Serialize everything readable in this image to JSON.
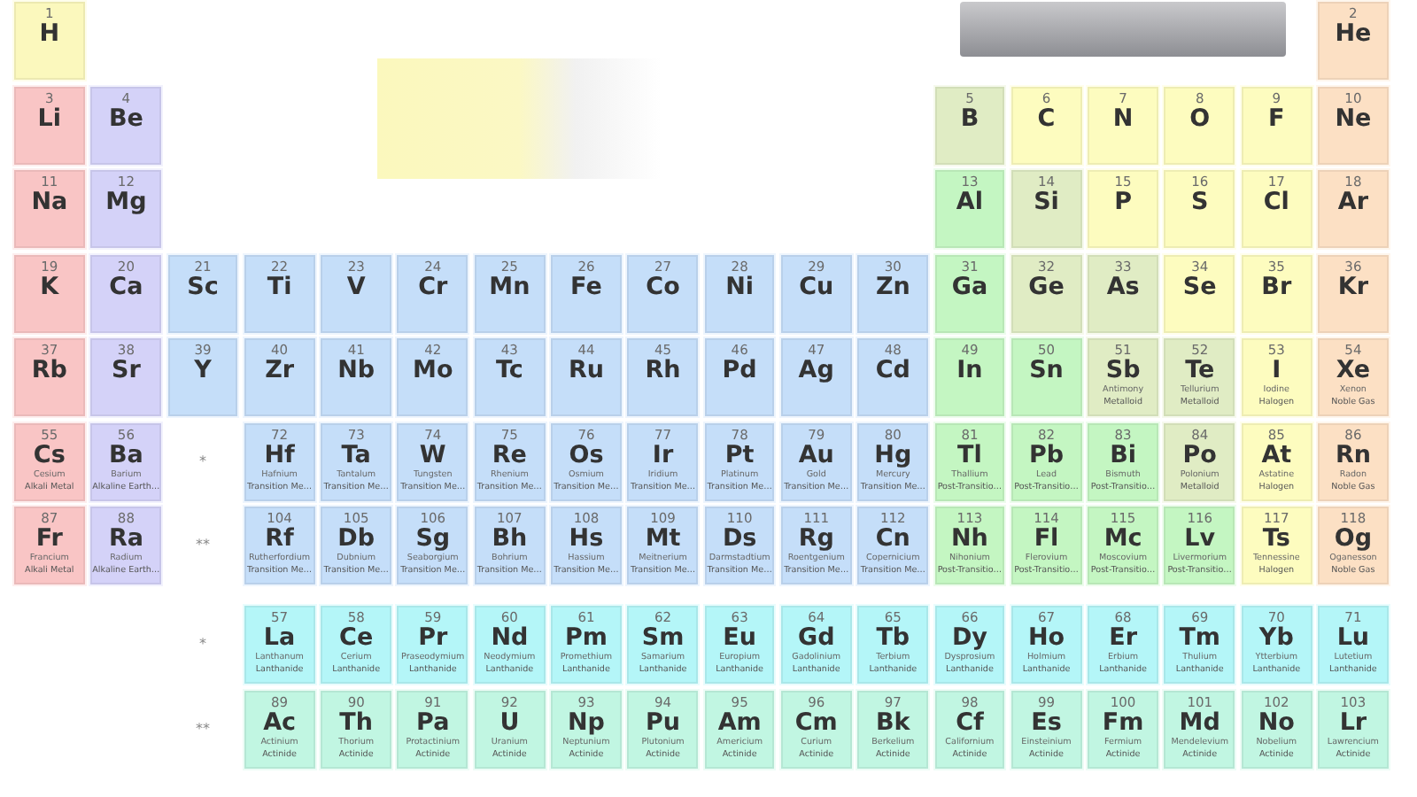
{
  "table": {
    "rows": [
      {
        "cells": [
          {
            "kind": "element",
            "number": "1",
            "symbol": "H",
            "color": "#fbf8bd"
          },
          {
            "kind": "empty"
          },
          {
            "kind": "empty"
          },
          {
            "kind": "empty"
          },
          {
            "kind": "empty"
          },
          {
            "kind": "empty"
          },
          {
            "kind": "empty"
          },
          {
            "kind": "empty"
          },
          {
            "kind": "empty"
          },
          {
            "kind": "empty"
          },
          {
            "kind": "empty"
          },
          {
            "kind": "empty"
          },
          {
            "kind": "empty"
          },
          {
            "kind": "empty"
          },
          {
            "kind": "empty"
          },
          {
            "kind": "empty"
          },
          {
            "kind": "empty"
          },
          {
            "kind": "element",
            "number": "2",
            "symbol": "He",
            "color": "#fce0c4"
          }
        ]
      },
      {
        "cells": [
          {
            "kind": "element",
            "number": "3",
            "symbol": "Li",
            "color": "#f9c5c5"
          },
          {
            "kind": "element",
            "number": "4",
            "symbol": "Be",
            "color": "#d4d2f8"
          },
          {
            "kind": "empty"
          },
          {
            "kind": "empty"
          },
          {
            "kind": "empty"
          },
          {
            "kind": "empty"
          },
          {
            "kind": "empty"
          },
          {
            "kind": "empty"
          },
          {
            "kind": "empty"
          },
          {
            "kind": "empty"
          },
          {
            "kind": "empty"
          },
          {
            "kind": "empty"
          },
          {
            "kind": "element",
            "number": "5",
            "symbol": "B",
            "color": "#e0ecc4"
          },
          {
            "kind": "element",
            "number": "6",
            "symbol": "C",
            "color": "#fdfcbf"
          },
          {
            "kind": "element",
            "number": "7",
            "symbol": "N",
            "color": "#fdfcbf"
          },
          {
            "kind": "element",
            "number": "8",
            "symbol": "O",
            "color": "#fdfcbf"
          },
          {
            "kind": "element",
            "number": "9",
            "symbol": "F",
            "color": "#fdfcbf"
          },
          {
            "kind": "element",
            "number": "10",
            "symbol": "Ne",
            "color": "#fce0c4"
          }
        ]
      },
      {
        "cells": [
          {
            "kind": "element",
            "number": "11",
            "symbol": "Na",
            "color": "#f9c5c5"
          },
          {
            "kind": "element",
            "number": "12",
            "symbol": "Mg",
            "color": "#d4d2f8"
          },
          {
            "kind": "empty"
          },
          {
            "kind": "empty"
          },
          {
            "kind": "empty"
          },
          {
            "kind": "empty"
          },
          {
            "kind": "empty"
          },
          {
            "kind": "empty"
          },
          {
            "kind": "empty"
          },
          {
            "kind": "empty"
          },
          {
            "kind": "empty"
          },
          {
            "kind": "empty"
          },
          {
            "kind": "element",
            "number": "13",
            "symbol": "Al",
            "color": "#c4f6c2"
          },
          {
            "kind": "element",
            "number": "14",
            "symbol": "Si",
            "color": "#e0ecc4"
          },
          {
            "kind": "element",
            "number": "15",
            "symbol": "P",
            "color": "#fdfcbf"
          },
          {
            "kind": "element",
            "number": "16",
            "symbol": "S",
            "color": "#fdfcbf"
          },
          {
            "kind": "element",
            "number": "17",
            "symbol": "Cl",
            "color": "#fdfcbf"
          },
          {
            "kind": "element",
            "number": "18",
            "symbol": "Ar",
            "color": "#fce0c4"
          }
        ]
      },
      {
        "cells": [
          {
            "kind": "element",
            "number": "19",
            "symbol": "K",
            "color": "#f9c5c5"
          },
          {
            "kind": "element",
            "number": "20",
            "symbol": "Ca",
            "color": "#d4d2f8"
          },
          {
            "kind": "element",
            "number": "21",
            "symbol": "Sc",
            "color": "#c5def9"
          },
          {
            "kind": "element",
            "number": "22",
            "symbol": "Ti",
            "color": "#c5def9"
          },
          {
            "kind": "element",
            "number": "23",
            "symbol": "V",
            "color": "#c5def9"
          },
          {
            "kind": "element",
            "number": "24",
            "symbol": "Cr",
            "color": "#c5def9"
          },
          {
            "kind": "element",
            "number": "25",
            "symbol": "Mn",
            "color": "#c5def9"
          },
          {
            "kind": "element",
            "number": "26",
            "symbol": "Fe",
            "color": "#c5def9"
          },
          {
            "kind": "element",
            "number": "27",
            "symbol": "Co",
            "color": "#c5def9"
          },
          {
            "kind": "element",
            "number": "28",
            "symbol": "Ni",
            "color": "#c5def9"
          },
          {
            "kind": "element",
            "number": "29",
            "symbol": "Cu",
            "color": "#c5def9"
          },
          {
            "kind": "element",
            "number": "30",
            "symbol": "Zn",
            "color": "#c5def9"
          },
          {
            "kind": "element",
            "number": "31",
            "symbol": "Ga",
            "color": "#c4f6c2"
          },
          {
            "kind": "element",
            "number": "32",
            "symbol": "Ge",
            "color": "#e0ecc4"
          },
          {
            "kind": "element",
            "number": "33",
            "symbol": "As",
            "color": "#e0ecc4"
          },
          {
            "kind": "element",
            "number": "34",
            "symbol": "Se",
            "color": "#fdfcbf"
          },
          {
            "kind": "element",
            "number": "35",
            "symbol": "Br",
            "color": "#fdfcbf"
          },
          {
            "kind": "element",
            "number": "36",
            "symbol": "Kr",
            "color": "#fce0c4"
          }
        ]
      },
      {
        "cells": [
          {
            "kind": "element",
            "number": "37",
            "symbol": "Rb",
            "color": "#f9c5c5"
          },
          {
            "kind": "element",
            "number": "38",
            "symbol": "Sr",
            "color": "#d4d2f8"
          },
          {
            "kind": "element",
            "number": "39",
            "symbol": "Y",
            "color": "#c5def9"
          },
          {
            "kind": "element",
            "number": "40",
            "symbol": "Zr",
            "color": "#c5def9"
          },
          {
            "kind": "element",
            "number": "41",
            "symbol": "Nb",
            "color": "#c5def9"
          },
          {
            "kind": "element",
            "number": "42",
            "symbol": "Mo",
            "color": "#c5def9"
          },
          {
            "kind": "element",
            "number": "43",
            "symbol": "Tc",
            "color": "#c5def9"
          },
          {
            "kind": "element",
            "number": "44",
            "symbol": "Ru",
            "color": "#c5def9"
          },
          {
            "kind": "element",
            "number": "45",
            "symbol": "Rh",
            "color": "#c5def9"
          },
          {
            "kind": "element",
            "number": "46",
            "symbol": "Pd",
            "color": "#c5def9"
          },
          {
            "kind": "element",
            "number": "47",
            "symbol": "Ag",
            "color": "#c5def9"
          },
          {
            "kind": "element",
            "number": "48",
            "symbol": "Cd",
            "color": "#c5def9"
          },
          {
            "kind": "element",
            "number": "49",
            "symbol": "In",
            "color": "#c4f6c2"
          },
          {
            "kind": "element",
            "number": "50",
            "symbol": "Sn",
            "color": "#c4f6c2"
          },
          {
            "kind": "element",
            "number": "51",
            "symbol": "Sb",
            "name": "Antimony",
            "category": "Metalloid",
            "color": "#e0ecc4"
          },
          {
            "kind": "element",
            "number": "52",
            "symbol": "Te",
            "name": "Tellurium",
            "category": "Metalloid",
            "color": "#e0ecc4"
          },
          {
            "kind": "element",
            "number": "53",
            "symbol": "I",
            "name": "Iodine",
            "category": "Halogen",
            "color": "#fdfcbf"
          },
          {
            "kind": "element",
            "number": "54",
            "symbol": "Xe",
            "name": "Xenon",
            "category": "Noble Gas",
            "color": "#fce0c4"
          }
        ]
      },
      {
        "cells": [
          {
            "kind": "element",
            "number": "55",
            "symbol": "Cs",
            "name": "Cesium",
            "category": "Alkali Metal",
            "color": "#f9c5c5"
          },
          {
            "kind": "element",
            "number": "56",
            "symbol": "Ba",
            "name": "Barium",
            "category": "Alkaline Earth…",
            "color": "#d4d2f8"
          },
          {
            "kind": "marker",
            "text": "*"
          },
          {
            "kind": "element",
            "number": "72",
            "symbol": "Hf",
            "name": "Hafnium",
            "category": "Transition Me…",
            "color": "#c5def9"
          },
          {
            "kind": "element",
            "number": "73",
            "symbol": "Ta",
            "name": "Tantalum",
            "category": "Transition Me…",
            "color": "#c5def9"
          },
          {
            "kind": "element",
            "number": "74",
            "symbol": "W",
            "name": "Tungsten",
            "category": "Transition Me…",
            "color": "#c5def9"
          },
          {
            "kind": "element",
            "number": "75",
            "symbol": "Re",
            "name": "Rhenium",
            "category": "Transition Me…",
            "color": "#c5def9"
          },
          {
            "kind": "element",
            "number": "76",
            "symbol": "Os",
            "name": "Osmium",
            "category": "Transition Me…",
            "color": "#c5def9"
          },
          {
            "kind": "element",
            "number": "77",
            "symbol": "Ir",
            "name": "Iridium",
            "category": "Transition Me…",
            "color": "#c5def9"
          },
          {
            "kind": "element",
            "number": "78",
            "symbol": "Pt",
            "name": "Platinum",
            "category": "Transition Me…",
            "color": "#c5def9"
          },
          {
            "kind": "element",
            "number": "79",
            "symbol": "Au",
            "name": "Gold",
            "category": "Transition Me…",
            "color": "#c5def9"
          },
          {
            "kind": "element",
            "number": "80",
            "symbol": "Hg",
            "name": "Mercury",
            "category": "Transition Me…",
            "color": "#c5def9"
          },
          {
            "kind": "element",
            "number": "81",
            "symbol": "Tl",
            "name": "Thallium",
            "category": "Post-Transitio…",
            "color": "#c4f6c2"
          },
          {
            "kind": "element",
            "number": "82",
            "symbol": "Pb",
            "name": "Lead",
            "category": "Post-Transitio…",
            "color": "#c4f6c2"
          },
          {
            "kind": "element",
            "number": "83",
            "symbol": "Bi",
            "name": "Bismuth",
            "category": "Post-Transitio…",
            "color": "#c4f6c2"
          },
          {
            "kind": "element",
            "number": "84",
            "symbol": "Po",
            "name": "Polonium",
            "category": "Metalloid",
            "color": "#e0ecc4"
          },
          {
            "kind": "element",
            "number": "85",
            "symbol": "At",
            "name": "Astatine",
            "category": "Halogen",
            "color": "#fdfcbf"
          },
          {
            "kind": "element",
            "number": "86",
            "symbol": "Rn",
            "name": "Radon",
            "category": "Noble Gas",
            "color": "#fce0c4"
          }
        ]
      },
      {
        "cells": [
          {
            "kind": "element",
            "number": "87",
            "symbol": "Fr",
            "name": "Francium",
            "category": "Alkali Metal",
            "color": "#f9c5c5"
          },
          {
            "kind": "element",
            "number": "88",
            "symbol": "Ra",
            "name": "Radium",
            "category": "Alkaline Earth…",
            "color": "#d4d2f8"
          },
          {
            "kind": "marker",
            "text": "**"
          },
          {
            "kind": "element",
            "number": "104",
            "symbol": "Rf",
            "name": "Rutherfordium",
            "category": "Transition Me…",
            "color": "#c5def9"
          },
          {
            "kind": "element",
            "number": "105",
            "symbol": "Db",
            "name": "Dubnium",
            "category": "Transition Me…",
            "color": "#c5def9"
          },
          {
            "kind": "element",
            "number": "106",
            "symbol": "Sg",
            "name": "Seaborgium",
            "category": "Transition Me…",
            "color": "#c5def9"
          },
          {
            "kind": "element",
            "number": "107",
            "symbol": "Bh",
            "name": "Bohrium",
            "category": "Transition Me…",
            "color": "#c5def9"
          },
          {
            "kind": "element",
            "number": "108",
            "symbol": "Hs",
            "name": "Hassium",
            "category": "Transition Me…",
            "color": "#c5def9"
          },
          {
            "kind": "element",
            "number": "109",
            "symbol": "Mt",
            "name": "Meitnerium",
            "category": "Transition Me…",
            "color": "#c5def9"
          },
          {
            "kind": "element",
            "number": "110",
            "symbol": "Ds",
            "name": "Darmstadtium",
            "category": "Transition Me…",
            "color": "#c5def9"
          },
          {
            "kind": "element",
            "number": "111",
            "symbol": "Rg",
            "name": "Roentgenium",
            "category": "Transition Me…",
            "color": "#c5def9"
          },
          {
            "kind": "element",
            "number": "112",
            "symbol": "Cn",
            "name": "Copernicium",
            "category": "Transition Me…",
            "color": "#c5def9"
          },
          {
            "kind": "element",
            "number": "113",
            "symbol": "Nh",
            "name": "Nihonium",
            "category": "Post-Transitio…",
            "color": "#c4f6c2"
          },
          {
            "kind": "element",
            "number": "114",
            "symbol": "Fl",
            "name": "Flerovium",
            "category": "Post-Transitio…",
            "color": "#c4f6c2"
          },
          {
            "kind": "element",
            "number": "115",
            "symbol": "Mc",
            "name": "Moscovium",
            "category": "Post-Transitio…",
            "color": "#c4f6c2"
          },
          {
            "kind": "element",
            "number": "116",
            "symbol": "Lv",
            "name": "Livermorium",
            "category": "Post-Transitio…",
            "color": "#c4f6c2"
          },
          {
            "kind": "element",
            "number": "117",
            "symbol": "Ts",
            "name": "Tennessine",
            "category": "Halogen",
            "color": "#fdfcbf"
          },
          {
            "kind": "element",
            "number": "118",
            "symbol": "Og",
            "name": "Oganesson",
            "category": "Noble Gas",
            "color": "#fce0c4"
          }
        ]
      }
    ]
  },
  "f_block": {
    "rows": [
      {
        "cells": [
          {
            "kind": "empty"
          },
          {
            "kind": "empty"
          },
          {
            "kind": "marker",
            "text": "*"
          },
          {
            "kind": "element",
            "number": "57",
            "symbol": "La",
            "name": "Lanthanum",
            "category": "Lanthanide",
            "color": "#b4f6f8"
          },
          {
            "kind": "element",
            "number": "58",
            "symbol": "Ce",
            "name": "Cerium",
            "category": "Lanthanide",
            "color": "#b4f6f8"
          },
          {
            "kind": "element",
            "number": "59",
            "symbol": "Pr",
            "name": "Praseodymium",
            "category": "Lanthanide",
            "color": "#b4f6f8"
          },
          {
            "kind": "element",
            "number": "60",
            "symbol": "Nd",
            "name": "Neodymium",
            "category": "Lanthanide",
            "color": "#b4f6f8"
          },
          {
            "kind": "element",
            "number": "61",
            "symbol": "Pm",
            "name": "Promethium",
            "category": "Lanthanide",
            "color": "#b4f6f8"
          },
          {
            "kind": "element",
            "number": "62",
            "symbol": "Sm",
            "name": "Samarium",
            "category": "Lanthanide",
            "color": "#b4f6f8"
          },
          {
            "kind": "element",
            "number": "63",
            "symbol": "Eu",
            "name": "Europium",
            "category": "Lanthanide",
            "color": "#b4f6f8"
          },
          {
            "kind": "element",
            "number": "64",
            "symbol": "Gd",
            "name": "Gadolinium",
            "category": "Lanthanide",
            "color": "#b4f6f8"
          },
          {
            "kind": "element",
            "number": "65",
            "symbol": "Tb",
            "name": "Terbium",
            "category": "Lanthanide",
            "color": "#b4f6f8"
          },
          {
            "kind": "element",
            "number": "66",
            "symbol": "Dy",
            "name": "Dysprosium",
            "category": "Lanthanide",
            "color": "#b4f6f8"
          },
          {
            "kind": "element",
            "number": "67",
            "symbol": "Ho",
            "name": "Holmium",
            "category": "Lanthanide",
            "color": "#b4f6f8"
          },
          {
            "kind": "element",
            "number": "68",
            "symbol": "Er",
            "name": "Erbium",
            "category": "Lanthanide",
            "color": "#b4f6f8"
          },
          {
            "kind": "element",
            "number": "69",
            "symbol": "Tm",
            "name": "Thulium",
            "category": "Lanthanide",
            "color": "#b4f6f8"
          },
          {
            "kind": "element",
            "number": "70",
            "symbol": "Yb",
            "name": "Ytterbium",
            "category": "Lanthanide",
            "color": "#b4f6f8"
          },
          {
            "kind": "element",
            "number": "71",
            "symbol": "Lu",
            "name": "Lutetium",
            "category": "Lanthanide",
            "color": "#b4f6f8"
          }
        ]
      },
      {
        "cells": [
          {
            "kind": "empty"
          },
          {
            "kind": "empty"
          },
          {
            "kind": "marker",
            "text": "**"
          },
          {
            "kind": "element",
            "number": "89",
            "symbol": "Ac",
            "name": "Actinium",
            "category": "Actinide",
            "color": "#c1f6e2"
          },
          {
            "kind": "element",
            "number": "90",
            "symbol": "Th",
            "name": "Thorium",
            "category": "Actinide",
            "color": "#c1f6e2"
          },
          {
            "kind": "element",
            "number": "91",
            "symbol": "Pa",
            "name": "Protactinium",
            "category": "Actinide",
            "color": "#c1f6e2"
          },
          {
            "kind": "element",
            "number": "92",
            "symbol": "U",
            "name": "Uranium",
            "category": "Actinide",
            "color": "#c1f6e2"
          },
          {
            "kind": "element",
            "number": "93",
            "symbol": "Np",
            "name": "Neptunium",
            "category": "Actinide",
            "color": "#c1f6e2"
          },
          {
            "kind": "element",
            "number": "94",
            "symbol": "Pu",
            "name": "Plutonium",
            "category": "Actinide",
            "color": "#c1f6e2"
          },
          {
            "kind": "element",
            "number": "95",
            "symbol": "Am",
            "name": "Americium",
            "category": "Actinide",
            "color": "#c1f6e2"
          },
          {
            "kind": "element",
            "number": "96",
            "symbol": "Cm",
            "name": "Curium",
            "category": "Actinide",
            "color": "#c1f6e2"
          },
          {
            "kind": "element",
            "number": "97",
            "symbol": "Bk",
            "name": "Berkelium",
            "category": "Actinide",
            "color": "#c1f6e2"
          },
          {
            "kind": "element",
            "number": "98",
            "symbol": "Cf",
            "name": "Californium",
            "category": "Actinide",
            "color": "#c1f6e2"
          },
          {
            "kind": "element",
            "number": "99",
            "symbol": "Es",
            "name": "Einsteinium",
            "category": "Actinide",
            "color": "#c1f6e2"
          },
          {
            "kind": "element",
            "number": "100",
            "symbol": "Fm",
            "name": "Fermium",
            "category": "Actinide",
            "color": "#c1f6e2"
          },
          {
            "kind": "element",
            "number": "101",
            "symbol": "Md",
            "name": "Mendelevium",
            "category": "Actinide",
            "color": "#c1f6e2"
          },
          {
            "kind": "element",
            "number": "102",
            "symbol": "No",
            "name": "Nobelium",
            "category": "Actinide",
            "color": "#c1f6e2"
          },
          {
            "kind": "element",
            "number": "103",
            "symbol": "Lr",
            "name": "Lawrencium",
            "category": "Actinide",
            "color": "#c1f6e2"
          }
        ]
      }
    ]
  }
}
